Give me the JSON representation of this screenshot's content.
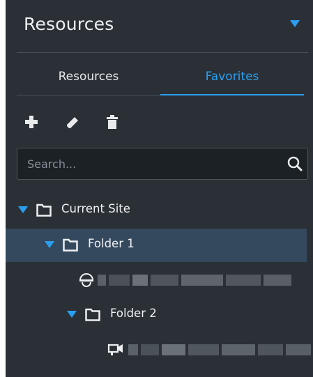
{
  "header": {
    "title": "Resources",
    "collapse_icon": "caret-down-icon"
  },
  "tabs": [
    {
      "label": "Resources",
      "active": false
    },
    {
      "label": "Favorites",
      "active": true
    }
  ],
  "toolbar": {
    "add_icon": "plus-icon",
    "edit_icon": "pencil-icon",
    "delete_icon": "trash-icon"
  },
  "search": {
    "placeholder": "Search...",
    "value": "",
    "icon": "search-icon"
  },
  "tree": {
    "current_site": {
      "label": "Current Site",
      "expanded": true
    },
    "folder1": {
      "label": "Folder 1",
      "expanded": true,
      "selected": true
    },
    "folder2": {
      "label": "Folder 2",
      "expanded": true
    },
    "dome_camera_icon": "dome-camera-icon",
    "bullet_camera_icon": "bullet-camera-icon"
  },
  "colors": {
    "panel": "#2a3036",
    "accent": "#2a9ff0",
    "selected_row": "#34495e",
    "text": "#eef0f2"
  }
}
